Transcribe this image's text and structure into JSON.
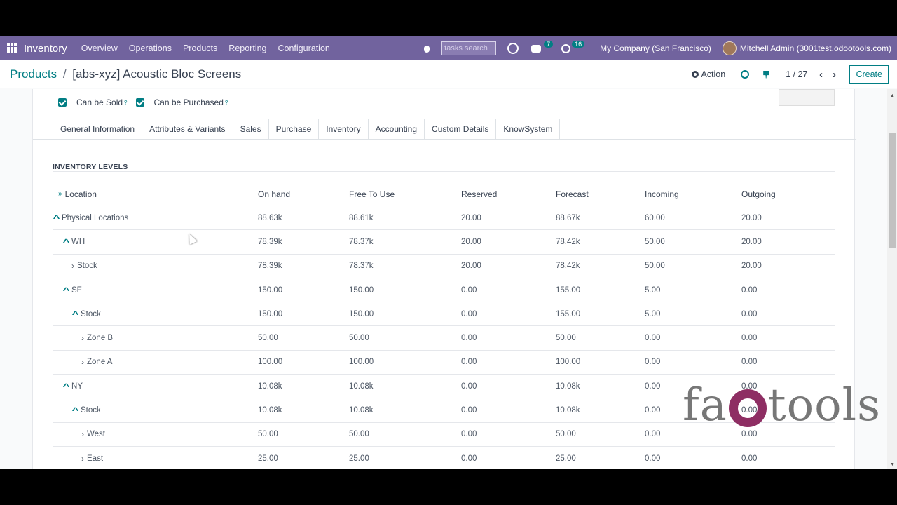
{
  "navbar": {
    "app_name": "Inventory",
    "menu": [
      "Overview",
      "Operations",
      "Products",
      "Reporting",
      "Configuration"
    ],
    "search_placeholder": "tasks search",
    "messages_count": "7",
    "activities_count": "16",
    "company": "My Company (San Francisco)",
    "user": "Mitchell Admin (3001test.odootools.com)"
  },
  "control": {
    "breadcrumb_parent": "Products",
    "breadcrumb_sep": "/",
    "breadcrumb_current": "[abs-xyz] Acoustic Bloc Screens",
    "action_label": "Action",
    "pager": "1 / 27",
    "create_label": "Create"
  },
  "form": {
    "can_be_sold": "Can be Sold",
    "can_be_purchased": "Can be Purchased",
    "help_mark": "?",
    "tabs": [
      "General Information",
      "Attributes & Variants",
      "Sales",
      "Purchase",
      "Inventory",
      "Accounting",
      "Custom Details",
      "KnowSystem"
    ],
    "active_tab": "Inventory",
    "section_title": "INVENTORY LEVELS"
  },
  "table": {
    "headers": [
      "Location",
      "On hand",
      "Free To Use",
      "Reserved",
      "Forecast",
      "Incoming",
      "Outgoing"
    ],
    "rows": [
      {
        "location": "Physical Locations",
        "on_hand": "88.63k",
        "free": "88.61k",
        "reserved": "20.00",
        "forecast": "88.67k",
        "incoming": "60.00",
        "outgoing": "20.00"
      },
      {
        "location": "WH",
        "on_hand": "78.39k",
        "free": "78.37k",
        "reserved": "20.00",
        "forecast": "78.42k",
        "incoming": "50.00",
        "outgoing": "20.00"
      },
      {
        "location": "Stock",
        "on_hand": "78.39k",
        "free": "78.37k",
        "reserved": "20.00",
        "forecast": "78.42k",
        "incoming": "50.00",
        "outgoing": "20.00"
      },
      {
        "location": "SF",
        "on_hand": "150.00",
        "free": "150.00",
        "reserved": "0.00",
        "forecast": "155.00",
        "incoming": "5.00",
        "outgoing": "0.00"
      },
      {
        "location": "Stock",
        "on_hand": "150.00",
        "free": "150.00",
        "reserved": "0.00",
        "forecast": "155.00",
        "incoming": "5.00",
        "outgoing": "0.00"
      },
      {
        "location": "Zone B",
        "on_hand": "50.00",
        "free": "50.00",
        "reserved": "0.00",
        "forecast": "50.00",
        "incoming": "0.00",
        "outgoing": "0.00"
      },
      {
        "location": "Zone A",
        "on_hand": "100.00",
        "free": "100.00",
        "reserved": "0.00",
        "forecast": "100.00",
        "incoming": "0.00",
        "outgoing": "0.00"
      },
      {
        "location": "NY",
        "on_hand": "10.08k",
        "free": "10.08k",
        "reserved": "0.00",
        "forecast": "10.08k",
        "incoming": "0.00",
        "outgoing": "0.00"
      },
      {
        "location": "Stock",
        "on_hand": "10.08k",
        "free": "10.08k",
        "reserved": "0.00",
        "forecast": "10.08k",
        "incoming": "0.00",
        "outgoing": "0.00"
      },
      {
        "location": "West",
        "on_hand": "50.00",
        "free": "50.00",
        "reserved": "0.00",
        "forecast": "50.00",
        "incoming": "0.00",
        "outgoing": "0.00"
      },
      {
        "location": "East",
        "on_hand": "25.00",
        "free": "25.00",
        "reserved": "0.00",
        "forecast": "25.00",
        "incoming": "0.00",
        "outgoing": "0.00"
      }
    ]
  },
  "watermark": {
    "left": "fa",
    "right": "tools"
  },
  "colors": {
    "navbar": "#71639e",
    "accent": "#017e84",
    "watermark_o": "#8e2e63"
  }
}
